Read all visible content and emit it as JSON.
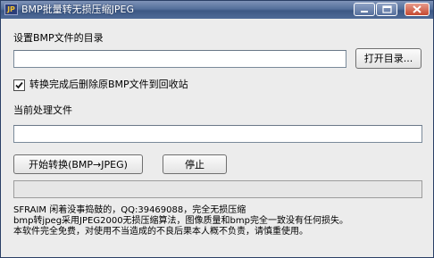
{
  "window": {
    "title": "BMP批量转无损压缩JPEG",
    "app_icon_text": "JP"
  },
  "directory": {
    "label": "设置BMP文件的目录",
    "value": "",
    "open_button": "打开目录..."
  },
  "options": {
    "delete_after_label": "转换完成后删除原BMP文件到回收站",
    "delete_after_checked": true
  },
  "current_file": {
    "label": "当前处理文件",
    "value": ""
  },
  "actions": {
    "start_label": "开始转换(BMP→JPEG)",
    "stop_label": "停止"
  },
  "progress": {
    "value": 0
  },
  "info_lines": [
    "SFRAIM  闲着没事捣鼓的，QQ:39469088，完全无损压缩",
    "bmp转jpeg采用JPEG2000无损压缩算法，图像质量和bmp完全一致没有任何损失。",
    "本软件完全免费，对使用不当造成的不良后果本人概不负责，请慎重使用。"
  ],
  "colors": {
    "titlebar": "#4e6a97",
    "window_bg": "#ececec",
    "close_button": "#c4482f"
  }
}
